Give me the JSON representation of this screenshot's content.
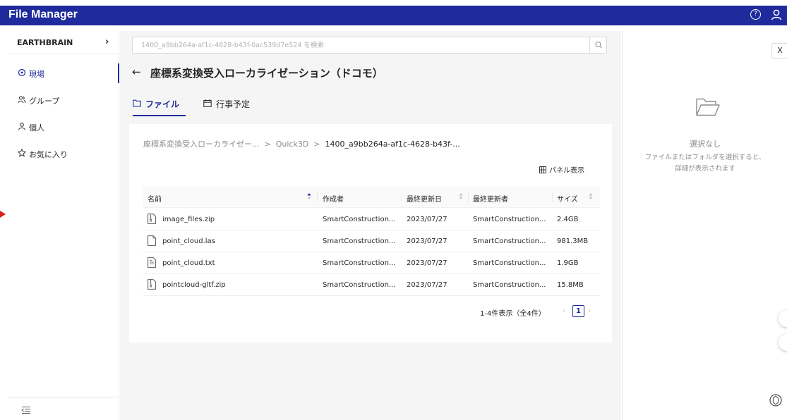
{
  "app": {
    "title": "File Manager",
    "help_glyph": "?"
  },
  "sidebar": {
    "org_name": "EARTHBRAIN",
    "org_chevron": "›",
    "items": [
      {
        "label": "現場",
        "icon": "location-pin-icon",
        "active": true
      },
      {
        "label": "グループ",
        "icon": "group-icon",
        "active": false
      },
      {
        "label": "個人",
        "icon": "user-icon",
        "active": false
      },
      {
        "label": "お気に入り",
        "icon": "star-icon",
        "active": false
      }
    ]
  },
  "search": {
    "placeholder": "1400_a9bb264a-af1c-4628-b43f-0ac539d7e524 を検索"
  },
  "page": {
    "back": "←",
    "title": "座標系変換受入ローカライゼーション（ドコモ）"
  },
  "tabs": [
    {
      "label": "ファイル",
      "icon": "folder-icon",
      "active": true
    },
    {
      "label": "行事予定",
      "icon": "calendar-icon",
      "active": false
    }
  ],
  "breadcrumb": {
    "items": [
      "座標系変換受入ローカライゼー...",
      "Quick3D",
      "1400_a9bb264a-af1c-4628-b43f-..."
    ],
    "separator": ">"
  },
  "panel_view_label": "パネル表示",
  "table": {
    "columns": [
      "名前",
      "作成者",
      "最終更新日",
      "最終更新者",
      "サイズ"
    ],
    "rows": [
      {
        "name": "image_files.zip",
        "icon": "zip-file-icon",
        "creator": "SmartConstruction...",
        "updated": "2023/07/27",
        "updater": "SmartConstruction...",
        "size": "2.4GB"
      },
      {
        "name": "point_cloud.las",
        "icon": "file-icon",
        "creator": "SmartConstruction...",
        "updated": "2023/07/27",
        "updater": "SmartConstruction...",
        "size": "981.3MB"
      },
      {
        "name": "point_cloud.txt",
        "icon": "text-file-icon",
        "creator": "SmartConstruction...",
        "updated": "2023/07/27",
        "updater": "SmartConstruction...",
        "size": "1.9GB"
      },
      {
        "name": "pointcloud-gltf.zip",
        "icon": "zip-file-icon",
        "creator": "SmartConstruction...",
        "updated": "2023/07/27",
        "updater": "SmartConstruction...",
        "size": "15.8MB"
      }
    ]
  },
  "pagination": {
    "summary": "1-4件表示（全4件）",
    "prev": "‹",
    "current": "1",
    "next": "›"
  },
  "detail": {
    "close_label": "X",
    "title": "選択なし",
    "description_line1": "ファイルまたはフォルダを選択すると、",
    "description_line2": "詳細が表示されます"
  },
  "colors": {
    "brand": "#1f2a9c",
    "accent_marker": "#e0201b"
  }
}
